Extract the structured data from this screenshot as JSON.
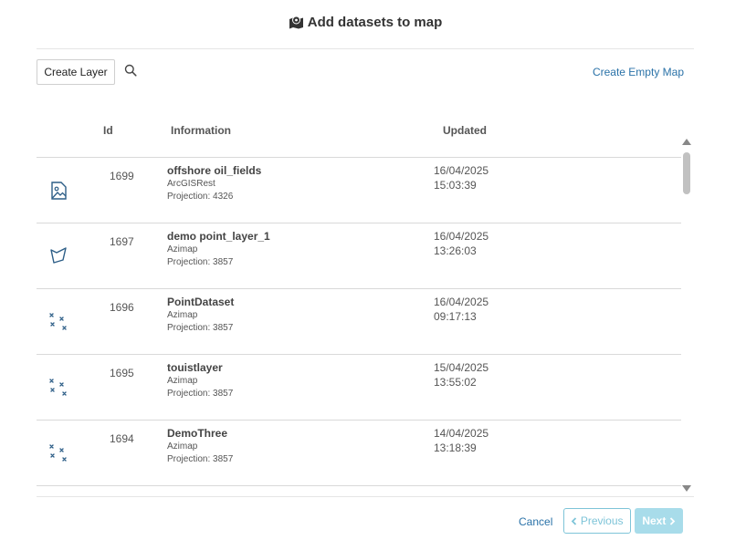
{
  "dialog": {
    "title": "Add datasets to map",
    "title_icon": "map-marker-icon"
  },
  "toolbar": {
    "create_layer_label": "Create Layer",
    "search_icon": "search-icon",
    "create_empty_map_label": "Create Empty Map"
  },
  "table": {
    "headers": {
      "id": "Id",
      "information": "Information",
      "updated": "Updated"
    },
    "rows": [
      {
        "icon": "image-icon",
        "id": "1699",
        "name": "offshore oil_fields",
        "source": "ArcGISRest",
        "projection": "Projection: 4326",
        "date": "16/04/2025",
        "time": "15:03:39"
      },
      {
        "icon": "polygon-icon",
        "id": "1697",
        "name": "demo point_layer_1",
        "source": "Azimap",
        "projection": "Projection: 3857",
        "date": "16/04/2025",
        "time": "13:26:03"
      },
      {
        "icon": "points-icon",
        "id": "1696",
        "name": "PointDataset",
        "source": "Azimap",
        "projection": "Projection: 3857",
        "date": "16/04/2025",
        "time": "09:17:13"
      },
      {
        "icon": "points-icon",
        "id": "1695",
        "name": "touistlayer",
        "source": "Azimap",
        "projection": "Projection: 3857",
        "date": "15/04/2025",
        "time": "13:55:02"
      },
      {
        "icon": "points-icon",
        "id": "1694",
        "name": "DemoThree",
        "source": "Azimap",
        "projection": "Projection: 3857",
        "date": "14/04/2025",
        "time": "13:18:39"
      }
    ]
  },
  "footer": {
    "cancel_label": "Cancel",
    "previous_label": "Previous",
    "next_label": "Next"
  },
  "colors": {
    "link": "#2a72a8",
    "icon": "#2d5e87",
    "prev_border": "#7ec4d8",
    "next_bg": "#a8dcea"
  }
}
